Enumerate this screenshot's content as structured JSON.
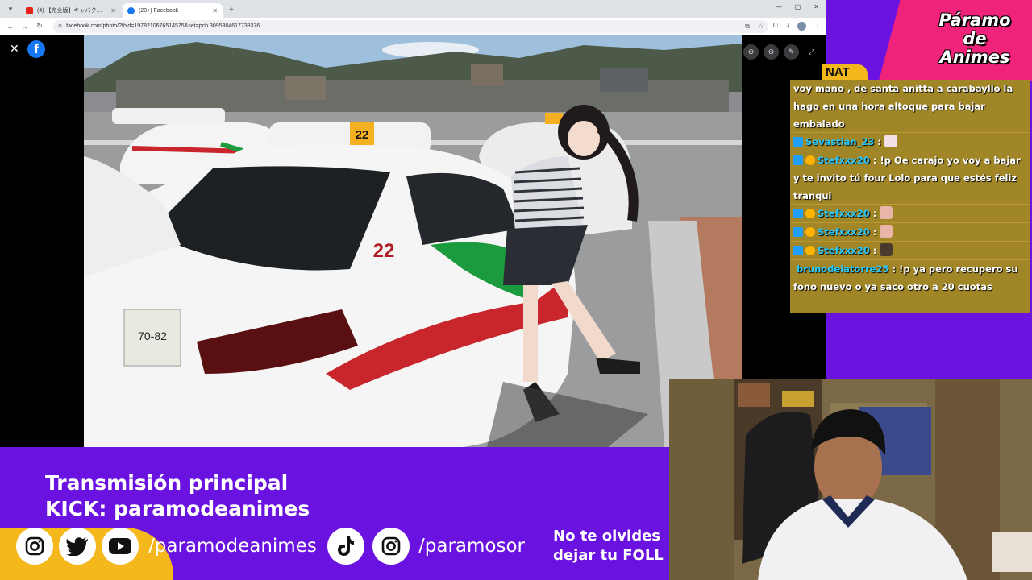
{
  "browser": {
    "tabs": [
      {
        "title": "(4) 【完全版】キャバクラ…",
        "favicon": "youtube-icon",
        "active": false
      },
      {
        "title": "(20+) Facebook",
        "favicon": "facebook-icon",
        "active": true
      }
    ],
    "url": "facebook.com/photo/?fbid=1978210676514575&set=pcb.3095304617738376"
  },
  "viewer": {
    "close_glyph": "✕",
    "logo_letter": "f"
  },
  "brand": {
    "line1": "Páramo",
    "line2": "de",
    "line3": "Animes"
  },
  "chat": {
    "label": "NAT",
    "messages": [
      {
        "user": "",
        "text": "voy mano , de santa anitta a carabayllo la hago en una hora altoque para bajar embalado",
        "badges": [],
        "emote": ""
      },
      {
        "user": "Sevastian_23",
        "text": "",
        "badges": [
          "badge"
        ],
        "emote": "ghost"
      },
      {
        "user": "Stefxxx20",
        "text": "!p Oe carajo yo voy a bajar y te invito tú four Lolo para que estés feliz tranqui",
        "badges": [
          "badge",
          "gold"
        ],
        "emote": ""
      },
      {
        "user": "Stefxxx20",
        "text": "",
        "badges": [
          "badge",
          "gold"
        ],
        "emote": "face"
      },
      {
        "user": "Stefxxx20",
        "text": "",
        "badges": [
          "badge",
          "gold"
        ],
        "emote": "face"
      },
      {
        "user": "Stefxxx20",
        "text": "",
        "badges": [
          "badge",
          "gold"
        ],
        "emote": "dark"
      },
      {
        "user": "brunodelatorre25",
        "text": "!p ya pero recupero su fono nuevo o ya saco otro a 20 cuotas",
        "badges": [],
        "emote": ""
      }
    ]
  },
  "banner": {
    "line1": "Transmisión principal",
    "line2": "KICK: paramodeanimes",
    "handle1": "/paramodeanimes",
    "handle2": "/paramosor",
    "reminder1": "No te olvides",
    "reminder2": "dejar tu FOLL"
  },
  "colors": {
    "purple": "#6a12e0",
    "pink": "#f0237a",
    "yellow": "#f5b81c",
    "chat_user": "#29c8ff"
  }
}
